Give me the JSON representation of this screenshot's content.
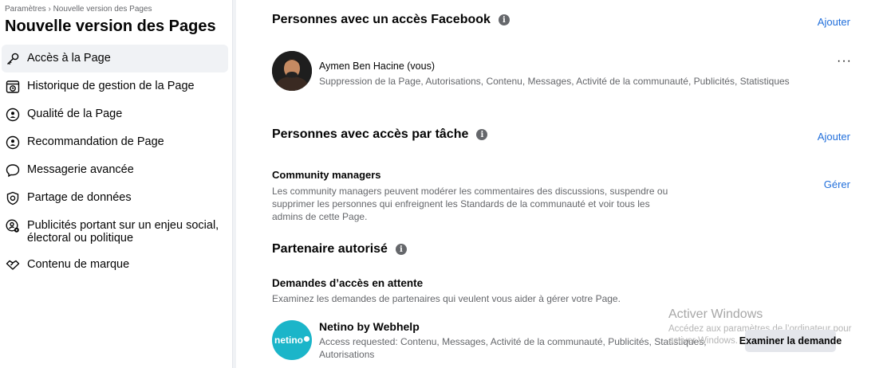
{
  "sidebar": {
    "breadcrumb": "Paramètres › Nouvelle version des Pages",
    "title": "Nouvelle version des Pages",
    "items": [
      {
        "label": "Accès à la Page",
        "icon": "key-icon",
        "active": true
      },
      {
        "label": "Historique de gestion de la Page",
        "icon": "history-icon"
      },
      {
        "label": "Qualité de la Page",
        "icon": "shield-user-icon"
      },
      {
        "label": "Recommandation de Page",
        "icon": "shield-user-icon"
      },
      {
        "label": "Messagerie avancée",
        "icon": "chat-bubble-icon"
      },
      {
        "label": "Partage de données",
        "icon": "shield-icon"
      },
      {
        "label": "Publicités portant sur un enjeu social, électoral ou politique",
        "icon": "user-gear-icon"
      },
      {
        "label": "Contenu de marque",
        "icon": "handshake-icon"
      }
    ]
  },
  "facebook_access": {
    "title": "Personnes avec un accès Facebook",
    "add_label": "Ajouter",
    "person": {
      "name": "Aymen Ben Hacine (vous)",
      "permissions": "Suppression de la Page, Autorisations, Contenu, Messages, Activité de la communauté, Publicités, Statistiques",
      "more_label": "···"
    }
  },
  "task_access": {
    "title": "Personnes avec accès par tâche",
    "add_label": "Ajouter",
    "role": {
      "name": "Community managers",
      "description": "Les community managers peuvent modérer les commentaires des discussions, suspendre ou supprimer les personnes qui enfreignent les Standards de la communauté et voir tous les admins de cette Page.",
      "manage_label": "Gérer"
    }
  },
  "partner": {
    "title": "Partenaire autorisé",
    "pending_title": "Demandes d’accès en attente",
    "pending_sub": "Examinez les demandes de partenaires qui veulent vous aider à gérer votre Page.",
    "request": {
      "name": "Netino by Webhelp",
      "logo_text": "netino",
      "details": "Access requested: Contenu, Messages, Activité de la communauté, Publicités, Statistiques, Autorisations",
      "button_label": "Examiner la demande"
    }
  },
  "watermark": {
    "title": "Activer Windows",
    "subtitle": "Accédez aux paramètres de l’ordinateur pour activer Windows."
  },
  "colors": {
    "accent": "#216fdb",
    "secondary_text": "#65676b",
    "active_bg": "#f0f2f5",
    "netino_brand": "#1bb5c9"
  }
}
